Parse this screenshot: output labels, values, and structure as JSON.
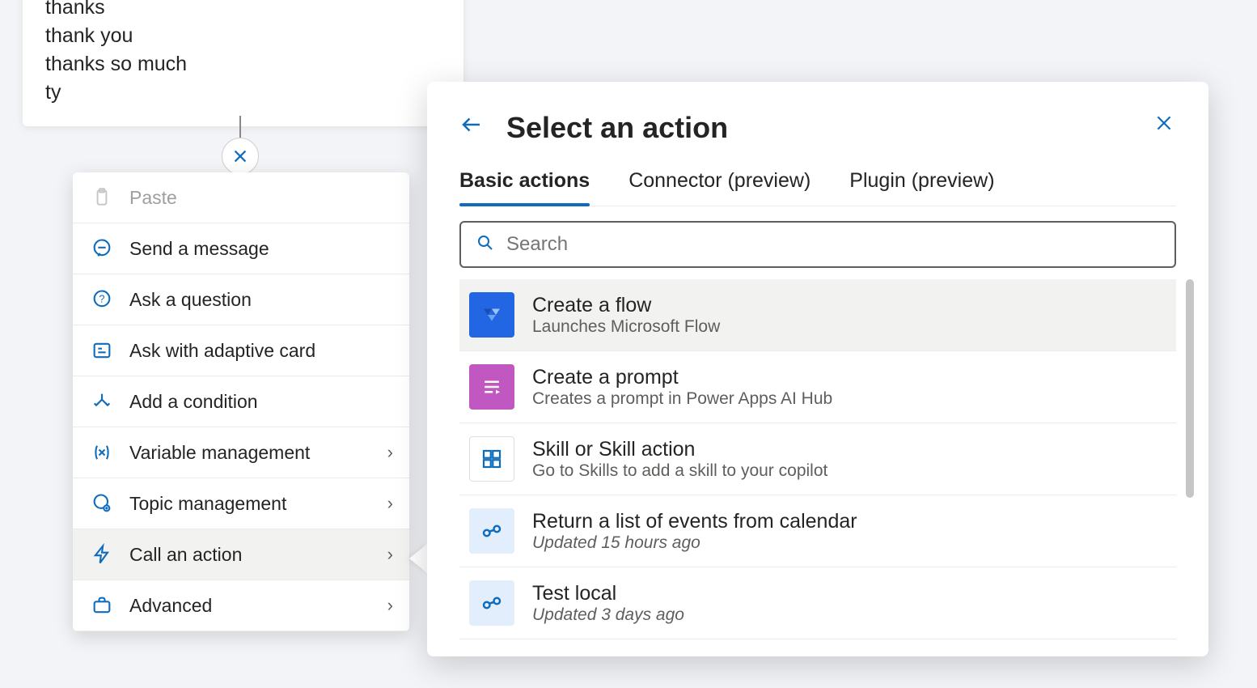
{
  "phrases": [
    "thanks",
    "thank you",
    "thanks so much",
    "ty"
  ],
  "ctx": {
    "paste": "Paste",
    "send": "Send a message",
    "ask": "Ask a question",
    "adaptive": "Ask with adaptive card",
    "condition": "Add a condition",
    "variable": "Variable management",
    "topic": "Topic management",
    "call": "Call an action",
    "advanced": "Advanced"
  },
  "panel": {
    "title": "Select an action",
    "tabs": {
      "basic": "Basic actions",
      "connector": "Connector (preview)",
      "plugin": "Plugin (preview)"
    },
    "search_placeholder": "Search",
    "actions": {
      "flow": {
        "title": "Create a flow",
        "sub": "Launches Microsoft Flow"
      },
      "prompt": {
        "title": "Create a prompt",
        "sub": "Creates a prompt in Power Apps AI Hub"
      },
      "skill": {
        "title": "Skill or Skill action",
        "sub": "Go to Skills to add a skill to your copilot"
      },
      "events": {
        "title": "Return a list of events from calendar",
        "sub": "Updated 15 hours ago"
      },
      "test": {
        "title": "Test local",
        "sub": "Updated 3 days ago"
      }
    }
  }
}
